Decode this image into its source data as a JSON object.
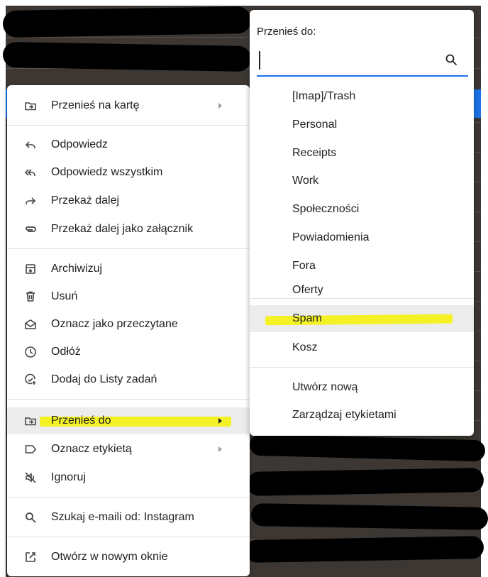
{
  "context_menu": {
    "items": [
      {
        "label": "Przenieś na kartę",
        "icon": "move-to-tab-icon",
        "submenu": true
      },
      {
        "label": "Odpowiedz",
        "icon": "reply-icon"
      },
      {
        "label": "Odpowiedz wszystkim",
        "icon": "reply-all-icon"
      },
      {
        "label": "Przekaż dalej",
        "icon": "forward-icon"
      },
      {
        "label": "Przekaż dalej jako załącznik",
        "icon": "attachment-icon"
      },
      {
        "label": "Archiwizuj",
        "icon": "archive-icon"
      },
      {
        "label": "Usuń",
        "icon": "trash-icon"
      },
      {
        "label": "Oznacz jako przeczytane",
        "icon": "mark-read-icon"
      },
      {
        "label": "Odłóż",
        "icon": "snooze-clock-icon"
      },
      {
        "label": "Dodaj do Listy zadań",
        "icon": "add-task-icon"
      },
      {
        "label": "Przenieś do",
        "icon": "move-to-icon",
        "submenu": true,
        "active": true
      },
      {
        "label": "Oznacz etykietą",
        "icon": "label-icon",
        "submenu": true
      },
      {
        "label": "Ignoruj",
        "icon": "mute-icon"
      },
      {
        "label": "Szukaj e-maili od: Instagram",
        "icon": "search-icon"
      },
      {
        "label": "Otwórz w nowym oknie",
        "icon": "open-new-window-icon"
      }
    ]
  },
  "move_to_menu": {
    "title": "Przenieś do:",
    "search_value": "",
    "labels": [
      "[Imap]/Trash",
      "Personal",
      "Receipts",
      "Work",
      "Społeczności",
      "Powiadomienia",
      "Fora",
      "Oferty"
    ],
    "system": [
      "Spam",
      "Kosz"
    ],
    "actions": [
      "Utwórz nową",
      "Zarządzaj etykietami"
    ]
  },
  "colors": {
    "highlighter": "#f5f20f",
    "accent": "#1a73e8",
    "redaction": "#000000"
  }
}
